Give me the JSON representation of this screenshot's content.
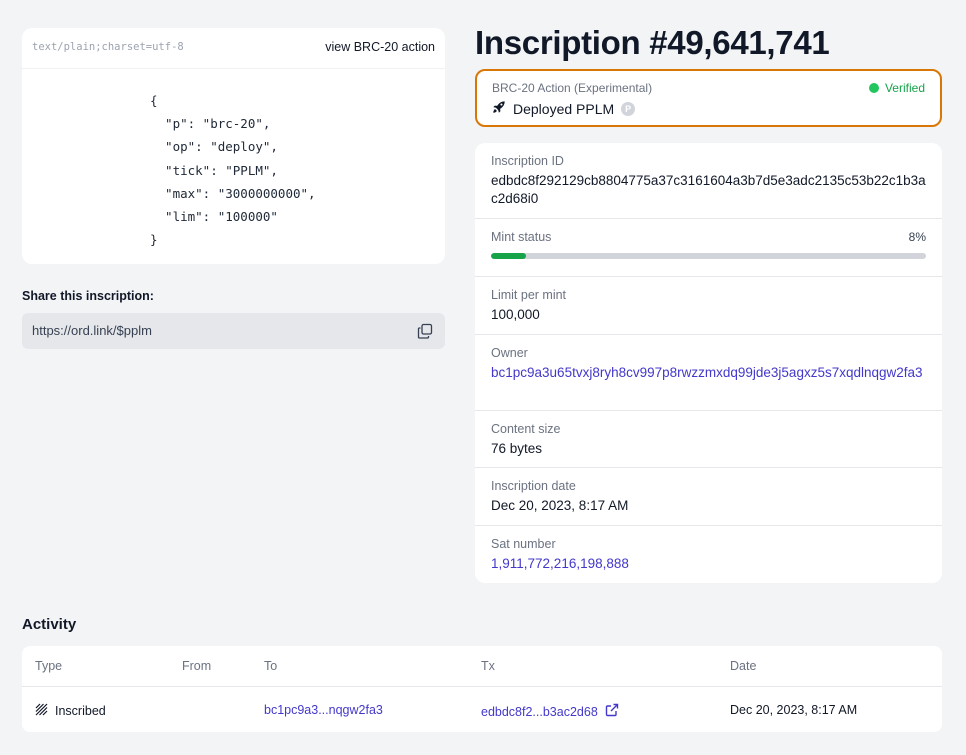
{
  "content": {
    "mime": "text/plain;charset=utf-8",
    "view_action": "view BRC-20 action",
    "json_text": "{\n  \"p\": \"brc-20\",\n  \"op\": \"deploy\",\n  \"tick\": \"PPLM\",\n  \"max\": \"3000000000\",\n  \"lim\": \"100000\"\n}"
  },
  "share": {
    "label": "Share this inscription:",
    "url": "https://ord.link/$pplm"
  },
  "title": "Inscription #49,641,741",
  "brc20": {
    "label": "BRC-20 Action (Experimental)",
    "status": "Verified",
    "action": "Deployed PPLM",
    "badge": "P"
  },
  "details": {
    "inscription_id": {
      "label": "Inscription ID",
      "value": "edbdc8f292129cb8804775a37c3161604a3b7d5e3adc2135c53b22c1b3ac2d68i0"
    },
    "mint_status": {
      "label": "Mint status",
      "percent_text": "8%",
      "fraction": 0.08
    },
    "limit_per_mint": {
      "label": "Limit per mint",
      "value": "100,000"
    },
    "owner": {
      "label": "Owner",
      "value": "bc1pc9a3u65tvxj8ryh8cv997p8rwzzmxdq99jde3j5agxz5s7xqdlnqgw2fa3"
    },
    "content_size": {
      "label": "Content size",
      "value": "76 bytes"
    },
    "inscription_date": {
      "label": "Inscription date",
      "value": "Dec 20, 2023, 8:17 AM"
    },
    "sat_number": {
      "label": "Sat number",
      "value": "1,911,772,216,198,888"
    }
  },
  "activity": {
    "title": "Activity",
    "columns": [
      "Type",
      "From",
      "To",
      "Tx",
      "Date"
    ],
    "rows": [
      {
        "type": "Inscribed",
        "from": "",
        "to": "bc1pc9a3...nqgw2fa3",
        "tx": "edbdc8f2...b3ac2d68",
        "date": "Dec 20, 2023, 8:17 AM"
      }
    ]
  },
  "colors": {
    "accent_border": "#d97706",
    "verified": "#16a34a",
    "link": "#4338ca",
    "progress_fill": "#16a34a"
  },
  "icons": [
    "copy-icon",
    "rocket-icon",
    "status-dot-icon",
    "ticker-badge-icon",
    "inscribed-icon",
    "external-link-icon"
  ]
}
